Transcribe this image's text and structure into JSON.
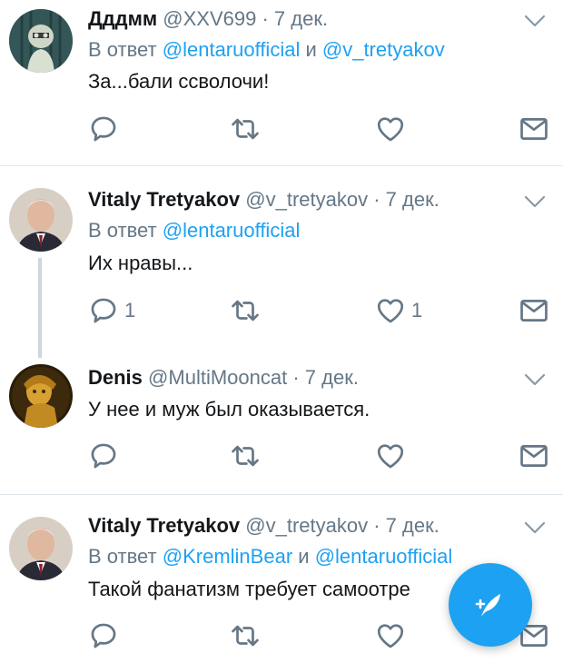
{
  "tweets": [
    {
      "name": "Дддмм",
      "handle": "@XXV699",
      "date": "7 дек.",
      "reply_prefix": "В ответ",
      "mention1": "@lentaruofficial",
      "reply_and": "и",
      "mention2": "@v_tretyakov",
      "text": "За...бали ссволочи!",
      "reply_count": "",
      "like_count": ""
    },
    {
      "name": "Vitaly Tretyakov",
      "handle": "@v_tretyakov",
      "date": "7 дек.",
      "reply_prefix": "В ответ",
      "mention1": "@lentaruofficial",
      "text": "Их нравы...",
      "reply_count": "1",
      "like_count": "1"
    },
    {
      "name": "Denis",
      "handle": "@MultiMooncat",
      "date": "7 дек.",
      "text": "У нее и муж был оказывается.",
      "reply_count": "",
      "like_count": ""
    },
    {
      "name": "Vitaly Tretyakov",
      "handle": "@v_tretyakov",
      "date": "7 дек.",
      "reply_prefix": "В ответ",
      "mention1": "@KremlinBear",
      "reply_and": "и",
      "mention2": "@lentaruofficial",
      "text": "Такой фанатизм требует самоотре",
      "reply_count": "",
      "like_count": ""
    }
  ],
  "separator_dot": "·",
  "icons": {
    "menu": "chevron-down-icon",
    "reply": "reply-icon",
    "retweet": "retweet-icon",
    "like": "heart-icon",
    "message": "envelope-icon",
    "compose": "compose-feather-icon"
  },
  "colors": {
    "accent": "#1da1f2",
    "text_primary": "#14171a",
    "text_secondary": "#657786",
    "divider": "#e1e8ed"
  }
}
